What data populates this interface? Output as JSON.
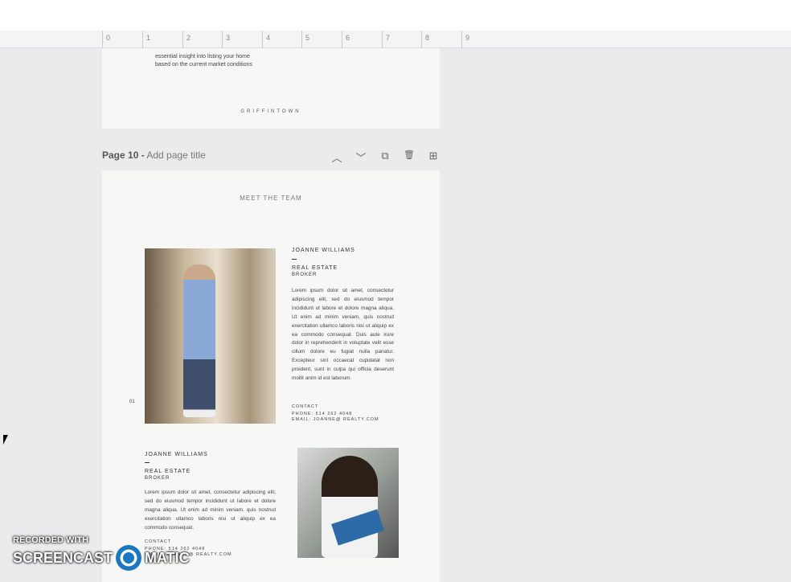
{
  "ruler": {
    "ticks": [
      "0",
      "1",
      "2",
      "3",
      "4",
      "5",
      "6",
      "7",
      "8",
      "9"
    ]
  },
  "page9": {
    "text_lines": [
      "essential insight into listing your home",
      "based on the current market conditions"
    ],
    "brand": "GRIFFINTOWN"
  },
  "page10": {
    "number_label": "Page 10 -",
    "title_placeholder": "Add page title",
    "actions": {
      "up": "︿",
      "down": "﹀",
      "duplicate": "⧉",
      "delete": "🗑",
      "add": "⊞"
    },
    "heading": "MEET THE TEAM",
    "index": "01",
    "member1": {
      "name": "JOANNE WILLIAMS",
      "role1": "REAL ESTATE",
      "role2": "BROKER",
      "bio": "Lorem ipsum dolor sit amet, consectetur adipiscing elit, sed do eiusmod tempor incididunt ut labore et dolore magna aliqua. Ut enim ad minim veniam, quis nostrud exercitation ullamco laboris nisi ut aliquip ex ea commodo consequat. Duis aute irure dolor in reprehenderit in voluptate velit esse cillum dolore eu fugiat nulla pariatur. Excepteur sint occaecat cupidatat non proident, sunt in culpa qui officia deserunt mollit anim id est laborum.",
      "contact_label": "CONTACT",
      "phone": "PHONE: 514 262 4048",
      "email": "EMAIL: JOANNE@ REALTY.COM"
    },
    "member2": {
      "name": "JOANNE WILLIAMS",
      "role1": "REAL ESTATE",
      "role2": "BROKER",
      "bio": "Lorem ipsum dolor sit amet, consectetur adipiscing elit, sed do eiusmod tempor incididunt ut labore et dolore magna aliqua. Ut enim ad minim veniam, quis nostrud exercitation ullamco laboris nisi ut aliquip ex ea commodo consequat.",
      "contact_label": "CONTACT",
      "phone": "PHONE: 514 262 4048",
      "email": "EMAIL: JOANNE@ REALTY.COM"
    }
  },
  "watermark": {
    "line1": "RECORDED WITH",
    "left": "SCREENCAST",
    "right": "MATIC"
  }
}
